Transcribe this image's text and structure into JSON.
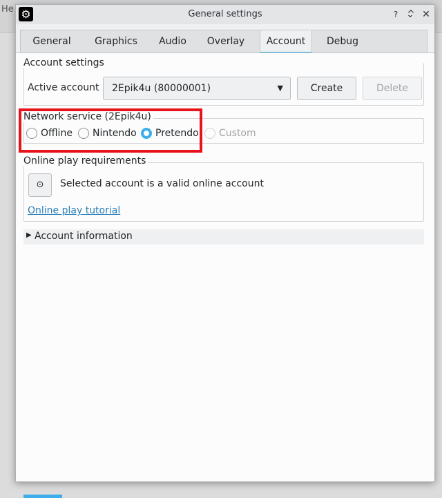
{
  "background": {
    "partial_text": "He"
  },
  "window": {
    "title": "General settings",
    "controls": {
      "help": "?",
      "minimize": "⌄",
      "maximize": "^",
      "close": "✕"
    }
  },
  "tabs": [
    {
      "label": "General"
    },
    {
      "label": "Graphics"
    },
    {
      "label": "Audio"
    },
    {
      "label": "Overlay"
    },
    {
      "label": "Account",
      "active": true
    },
    {
      "label": "Debug"
    }
  ],
  "account_settings": {
    "group_title": "Account settings",
    "active_account_label": "Active account",
    "active_account_value": "2Epik4u (80000001)",
    "create_label": "Create",
    "delete_label": "Delete"
  },
  "network_service": {
    "group_title": "Network service (2Epik4u)",
    "options": [
      {
        "label": "Offline",
        "checked": false,
        "enabled": true
      },
      {
        "label": "Nintendo",
        "checked": false,
        "enabled": true
      },
      {
        "label": "Pretendo",
        "checked": true,
        "enabled": true
      },
      {
        "label": "Custom",
        "checked": false,
        "enabled": false
      }
    ]
  },
  "online_play": {
    "group_title": "Online play requirements",
    "status_text": "Selected account is a valid online account",
    "tutorial_link": "Online play tutorial"
  },
  "account_information": {
    "label": "Account information",
    "expanded": false
  },
  "colors": {
    "accent": "#3daee9",
    "highlight_box": "#e8131a",
    "link": "#2980b9"
  },
  "icons": {
    "app": "gear-icon",
    "dropdown": "chevron-down-icon",
    "status": "check-circle-icon",
    "expander": "triangle-right-icon"
  }
}
